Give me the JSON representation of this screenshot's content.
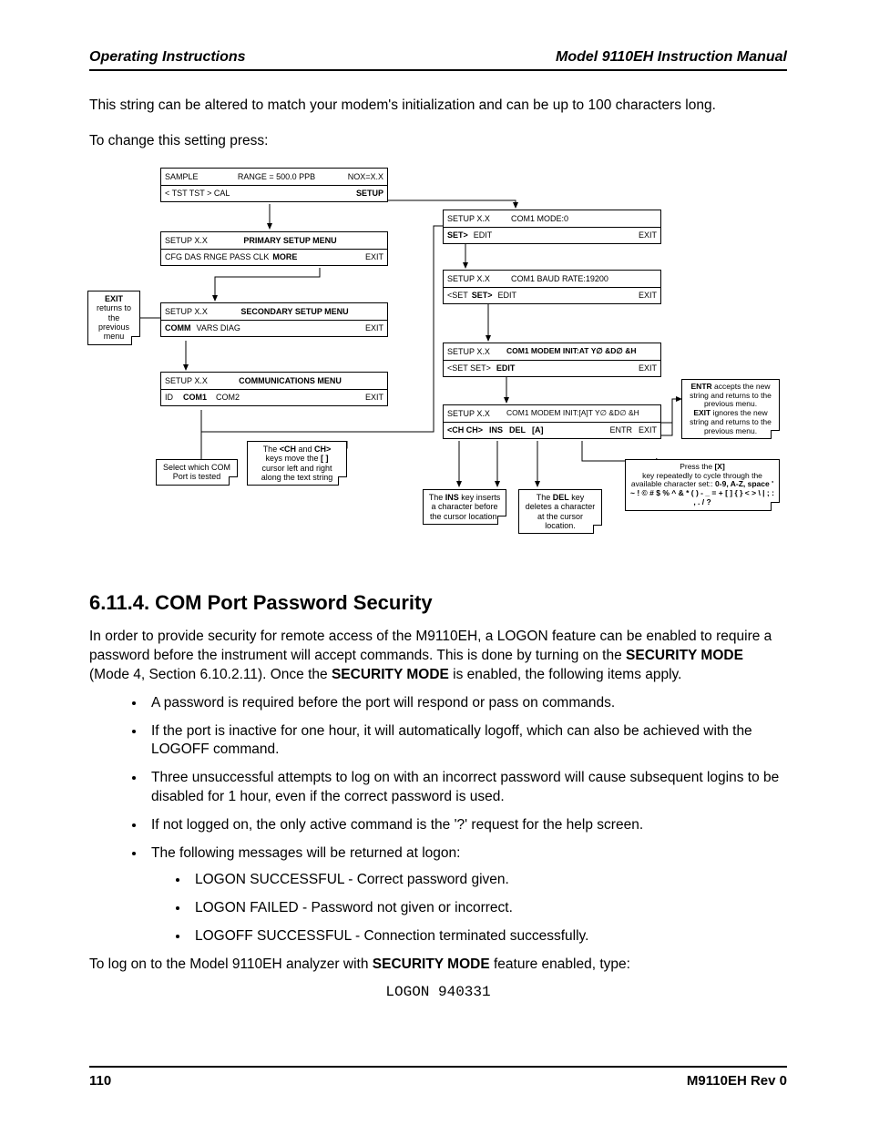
{
  "header": {
    "left": "Operating Instructions",
    "right": "Model 9110EH Instruction Manual"
  },
  "intro1": "This string can be altered to match your modem's initialization and can be up to 100 characters long.",
  "intro2": "To change this setting press:",
  "diagram": {
    "sample": {
      "l": "SAMPLE",
      "c": "RANGE = 500.0 PPB",
      "r": "NOX=X.X",
      "b1": "< TST  TST >  CAL",
      "b2": "SETUP"
    },
    "primary": {
      "t1": "SETUP X.X",
      "t2": "PRIMARY SETUP MENU",
      "b": "CFG  DAS  RNGE  PASS  CLK",
      "more": "MORE",
      "exit": "EXIT"
    },
    "secondary": {
      "t1": "SETUP X.X",
      "t2": "SECONDARY SETUP MENU",
      "b1": "COMM",
      "b2": "VARS  DIAG",
      "exit": "EXIT"
    },
    "comms": {
      "t1": "SETUP X.X",
      "t2": "COMMUNICATIONS MENU",
      "id": "ID",
      "c1": "COM1",
      "c2": "COM2",
      "exit": "EXIT"
    },
    "mode": {
      "t1": "SETUP X.X",
      "t2": "COM1 MODE:0",
      "b1": "SET>",
      "b2": "EDIT",
      "exit": "EXIT"
    },
    "baud": {
      "t1": "SETUP X.X",
      "t2": "COM1 BAUD RATE:19200",
      "b1": "<SET",
      "b2": "SET>",
      "b3": "EDIT",
      "exit": "EXIT"
    },
    "minit": {
      "t1": "SETUP X.X",
      "t2": "COM1 MODEM INIT:AT  Y∅ &D∅ &H",
      "b1": "<SET  SET>",
      "b2": "EDIT",
      "exit": "EXIT"
    },
    "edit": {
      "t1": "SETUP X.X",
      "t2": "COM1 MODEM INIT:[A]T  Y∅ &D∅ &H",
      "b1": "<CH  CH>",
      "b2": "INS",
      "b3": "DEL",
      "b4": "[A]",
      "b5": "ENTR",
      "b6": "EXIT"
    },
    "note_exit": "returns to the previous menu",
    "note_exit_b": "EXIT",
    "note_select": "Select which COM Port is tested",
    "note_ch_pre": "The",
    "note_ch_b1": "<CH",
    "note_ch_and": "and",
    "note_ch_b2": "CH>",
    "note_ch_mid": "keys move the",
    "note_ch_b3": "[ ]",
    "note_ch_rest": "cursor left and right along the text string",
    "note_ins_pre": "The",
    "note_ins_b": "INS",
    "note_ins_rest": "key inserts a character before the cursor location.",
    "note_del_pre": "The",
    "note_del_b": "DEL",
    "note_del_rest": "key deletes a character at the cursor location.",
    "note_entr_b1": "ENTR",
    "note_entr_t1": "accepts the new string and returns to the previous menu.",
    "note_entr_b2": "EXIT",
    "note_entr_t2": "ignores the new string and returns to the previous menu.",
    "note_x_pre": "Press the",
    "note_x_b": "[X]",
    "note_x_mid": "key repeatedly to cycle through the available character set::",
    "note_x_set": "0-9, A-Z, space ' ~ ! © # $ % ^ & * ( ) - _ = + [ ] { } < > \\ | ; : , . / ?"
  },
  "section": {
    "title": "6.11.4. COM Port Password Security",
    "p1a": "In order to provide security for remote access of the M9110EH, a LOGON feature can be enabled to require a password before the instrument will accept commands. This is done by turning on the ",
    "p1b": "SECURITY MODE",
    "p1c": " (Mode 4, Section 6.10.2.11). Once the ",
    "p1d": "SECURITY MODE",
    "p1e": " is enabled, the following items apply.",
    "bullets": [
      "A password is required before the port will respond or pass on commands.",
      "If the port is inactive for one hour, it will automatically logoff, which can also be achieved with the LOGOFF command.",
      "Three unsuccessful attempts to log on with an incorrect password will cause subsequent logins to be disabled for 1 hour, even if the correct password is used.",
      "If not logged on, the only active command is the '?' request for the help screen.",
      "The following messages will be returned at logon:"
    ],
    "sub": [
      "LOGON SUCCESSFUL - Correct password given.",
      "LOGON FAILED - Password not given or incorrect.",
      "LOGOFF SUCCESSFUL - Connection terminated successfully."
    ],
    "p2a": "To log on to the Model 9110EH analyzer with ",
    "p2b": "SECURITY MODE",
    "p2c": " feature enabled, type:",
    "cmd": "LOGON 940331"
  },
  "footer": {
    "left": "110",
    "right": "M9110EH Rev 0"
  }
}
